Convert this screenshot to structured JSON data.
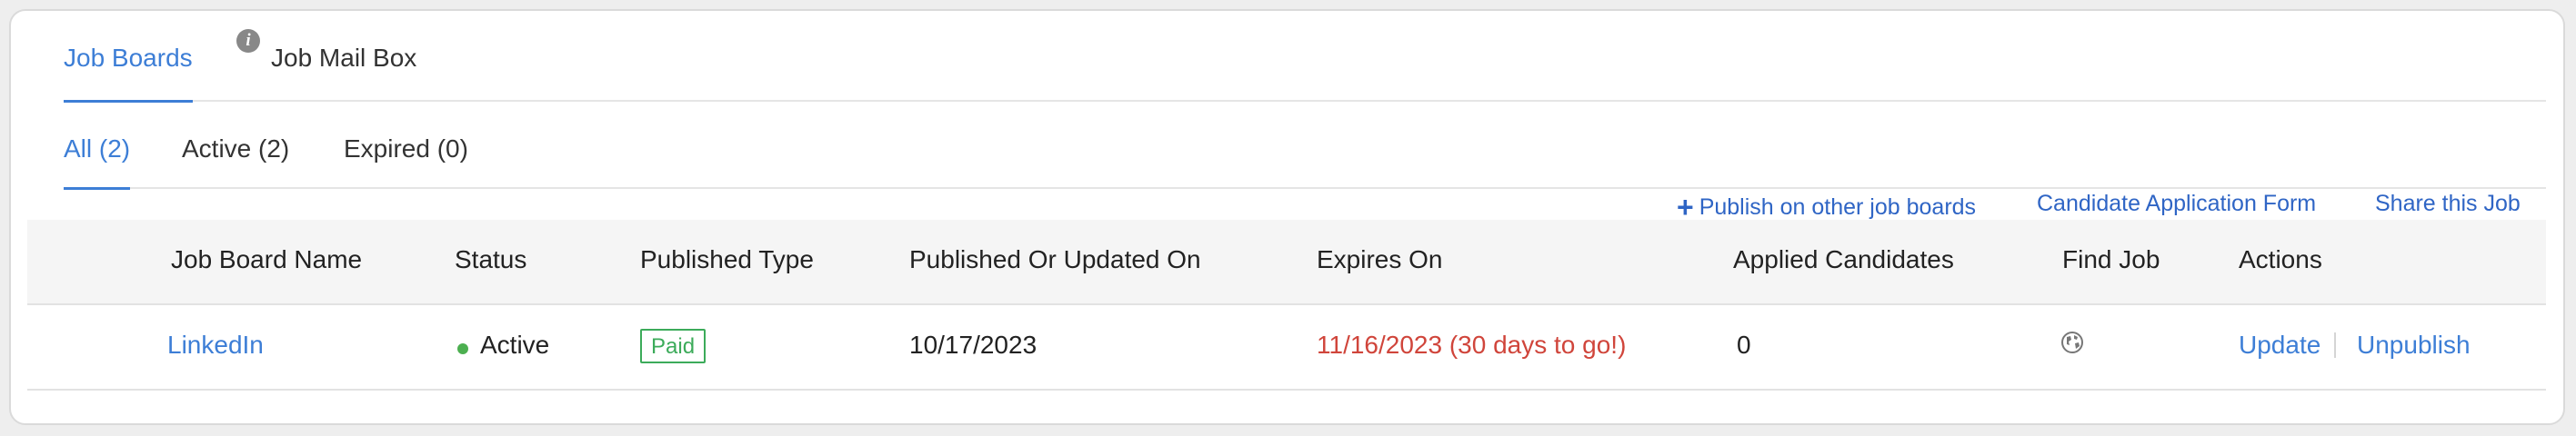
{
  "tabs_top": [
    {
      "label": "Job Boards",
      "active": true
    },
    {
      "label": "Job Mail Box",
      "active": false
    }
  ],
  "tabs_sub": [
    {
      "label": "All (2)",
      "active": true
    },
    {
      "label": "Active (2)",
      "active": false
    },
    {
      "label": "Expired (0)",
      "active": false
    }
  ],
  "actions_bar": {
    "publish_other": "Publish on other job boards",
    "candidate_form": "Candidate Application Form",
    "share_job": "Share this Job"
  },
  "table": {
    "headers": [
      "Job Board Name",
      "Status",
      "Published Type",
      "Published Or Updated On",
      "Expires On",
      "Applied Candidates",
      "Find Job",
      "Actions"
    ],
    "rows": [
      {
        "job_board": "LinkedIn",
        "status": "Active",
        "published_type": "Paid",
        "published_on": "10/17/2023",
        "expires_on": "11/16/2023 (30 days to go!)",
        "applied": "0",
        "actions": {
          "update": "Update",
          "unpublish": "Unpublish"
        }
      }
    ]
  },
  "colors": {
    "accent": "#3d7ed6",
    "expires": "#d0453b",
    "paid": "#3cab5a",
    "active_dot": "#4caf50"
  }
}
